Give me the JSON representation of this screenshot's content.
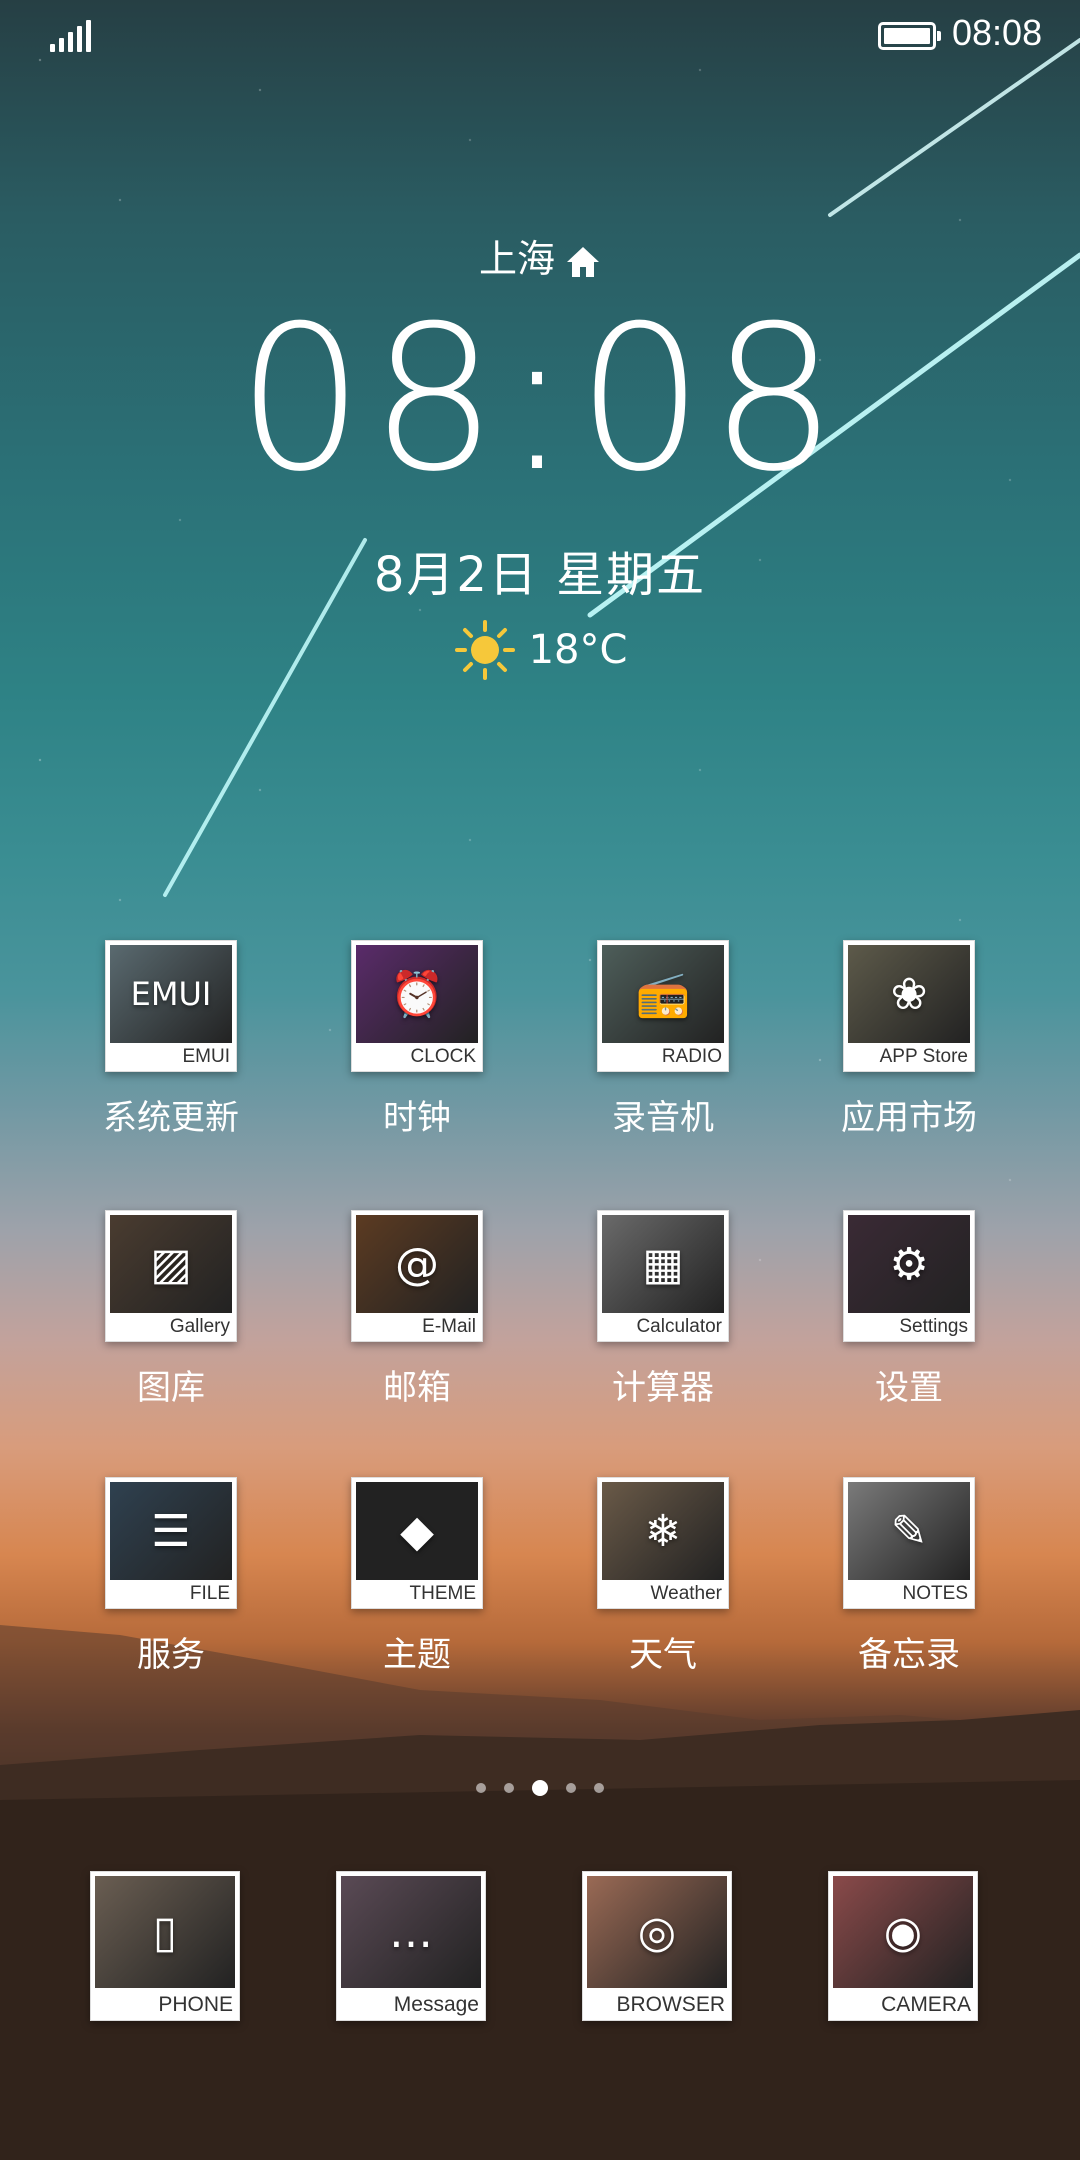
{
  "status_bar": {
    "time": "08:08"
  },
  "clock_widget": {
    "city": "上海",
    "time": "08:08",
    "date": "8月2日 星期五",
    "temperature": "18°C"
  },
  "apps": [
    {
      "caption": "EMUI",
      "label": "系统更新",
      "icon": "emui-update-icon",
      "color": "#5a6a70"
    },
    {
      "caption": "CLOCK",
      "label": "时钟",
      "icon": "alarm-clock-icon",
      "color": "#5a2b6a"
    },
    {
      "caption": "RADIO",
      "label": "录音机",
      "icon": "radio-icon",
      "color": "#4e5e5a"
    },
    {
      "caption": "APP  Store",
      "label": "应用市场",
      "icon": "huawei-logo-icon",
      "color": "#5d5a4a"
    },
    {
      "caption": "Gallery",
      "label": "图库",
      "icon": "picture-icon",
      "color": "#4a3c30"
    },
    {
      "caption": "E-Mail",
      "label": "邮箱",
      "icon": "at-sign-icon",
      "color": "#5c3b22"
    },
    {
      "caption": "Calculator",
      "label": "计算器",
      "icon": "calculator-icon",
      "color": "#6a6a6a"
    },
    {
      "caption": "Settings",
      "label": "设置",
      "icon": "gear-icon",
      "color": "#3a2a35"
    },
    {
      "caption": "FILE",
      "label": "服务",
      "icon": "inbox-tray-icon",
      "color": "#2f4150"
    },
    {
      "caption": "THEME",
      "label": "主题",
      "icon": "diamond-icon",
      "color": "#222222"
    },
    {
      "caption": "Weather",
      "label": "天气",
      "icon": "snowflake-icon",
      "color": "#6a5a48"
    },
    {
      "caption": "NOTES",
      "label": "备忘录",
      "icon": "tag-icon",
      "color": "#7a7a7a"
    }
  ],
  "dock": [
    {
      "caption": "PHONE",
      "icon": "phone-icon",
      "color": "#6a5e52"
    },
    {
      "caption": "Message",
      "icon": "message-bubble-icon",
      "color": "#5a4a55"
    },
    {
      "caption": "BROWSER",
      "icon": "compass-icon",
      "color": "#9a6a55"
    },
    {
      "caption": "CAMERA",
      "icon": "camera-icon",
      "color": "#8a4a4a"
    }
  ],
  "page_indicator": {
    "count": 5,
    "active": 3
  }
}
